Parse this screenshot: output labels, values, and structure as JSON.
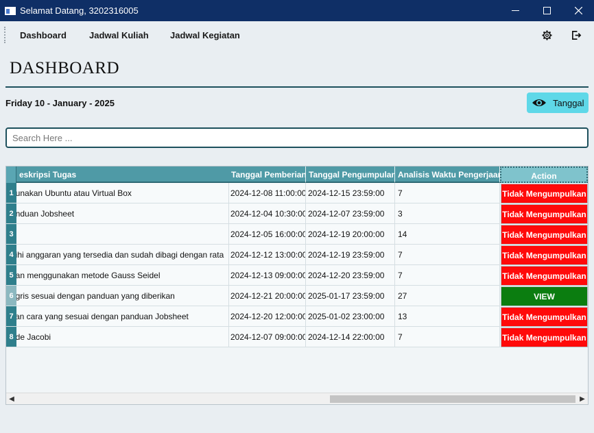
{
  "window": {
    "title": "Selamat Datang, 3202316005"
  },
  "menu": {
    "items": [
      "Dashboard",
      "Jadwal Kuliah",
      "Jadwal Kegiatan"
    ],
    "settings_icon": "gear-icon",
    "logout_icon": "logout-icon"
  },
  "page": {
    "title": "DASHBOARD",
    "date": "Friday 10 - January - 2025",
    "tanggal_button": "Tanggal",
    "search_placeholder": "Search Here ..."
  },
  "table": {
    "headers": [
      "eskripsi Tugas",
      "Tanggal Pemberian",
      "Tanggal Pengumpulan",
      "Analisis Waktu Pengerjaan",
      "Action"
    ],
    "rows": [
      {
        "num": "1",
        "desc": "gunakan Ubuntu atau Virtual Box",
        "given": "2024-12-08 11:00:00",
        "due": "2024-12-15 23:59:00",
        "analysis": "7",
        "action": "Tidak Mengumpulkan",
        "status": "red"
      },
      {
        "num": "2",
        "desc": "anduan Jobsheet",
        "given": "2024-12-04 10:30:00",
        "due": "2024-12-07 23:59:00",
        "analysis": "3",
        "action": "Tidak Mengumpulkan",
        "status": "red"
      },
      {
        "num": "3",
        "desc": "",
        "given": "2024-12-05 16:00:00",
        "due": "2024-12-19 20:00:00",
        "analysis": "14",
        "action": "Tidak Mengumpulkan",
        "status": "red"
      },
      {
        "num": "4",
        "desc": "bihi anggaran yang tersedia dan sudah dibagi dengan rata",
        "given": "2024-12-12 13:00:00",
        "due": "2024-12-19 23:59:00",
        "analysis": "7",
        "action": "Tidak Mengumpulkan",
        "status": "red"
      },
      {
        "num": "5",
        "desc": "gan menggunakan metode Gauss Seidel",
        "given": "2024-12-13 09:00:00",
        "due": "2024-12-20 23:59:00",
        "analysis": "7",
        "action": "Tidak Mengumpulkan",
        "status": "red"
      },
      {
        "num": "6",
        "desc": "ggris sesuai dengan panduan yang diberikan",
        "given": "2024-12-21 20:00:00",
        "due": "2025-01-17 23:59:00",
        "analysis": "27",
        "action": "VIEW",
        "status": "green"
      },
      {
        "num": "7",
        "desc": "yan cara yang sesuai dengan panduan Jobsheet",
        "given": "2024-12-20 12:00:00",
        "due": "2025-01-02 23:00:00",
        "analysis": "13",
        "action": "Tidak Mengumpulkan",
        "status": "red"
      },
      {
        "num": "8",
        "desc": "ode Jacobi",
        "given": "2024-12-07 09:00:00",
        "due": "2024-12-14 22:00:00",
        "analysis": "7",
        "action": "Tidak Mengumpulkan",
        "status": "red"
      }
    ]
  },
  "colors": {
    "titlebar": "#0f2f66",
    "header": "#4f9aa6",
    "accent": "#5fd8e8",
    "danger": "#ff0a0a",
    "success": "#0b7d10"
  }
}
